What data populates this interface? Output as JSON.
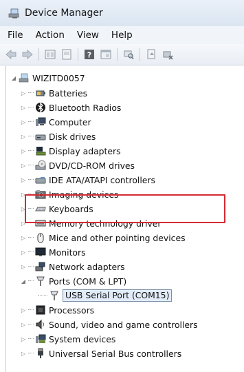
{
  "window": {
    "title": "Device Manager"
  },
  "menu": [
    "File",
    "Action",
    "View",
    "Help"
  ],
  "toolbar": {
    "buttons": [
      "back-icon",
      "forward-icon",
      "properties-icon",
      "update-icon",
      "help-icon",
      "console-icon",
      "scan-icon",
      "driver-icon",
      "disable-icon"
    ]
  },
  "tree": {
    "root": "WIZITD0057",
    "items": [
      {
        "label": "Batteries",
        "icon": "battery-icon"
      },
      {
        "label": "Bluetooth Radios",
        "icon": "bluetooth-icon"
      },
      {
        "label": "Computer",
        "icon": "computer-icon"
      },
      {
        "label": "Disk drives",
        "icon": "disk-drive-icon"
      },
      {
        "label": "Display adapters",
        "icon": "display-adapter-icon"
      },
      {
        "label": "DVD/CD-ROM drives",
        "icon": "dvd-drive-icon"
      },
      {
        "label": "IDE ATA/ATAPI controllers",
        "icon": "ide-controller-icon"
      },
      {
        "label": "Imaging devices",
        "icon": "imaging-device-icon"
      },
      {
        "label": "Keyboards",
        "icon": "keyboard-icon"
      },
      {
        "label": "Memory technology driver",
        "icon": "memory-icon"
      },
      {
        "label": "Mice and other pointing devices",
        "icon": "mouse-icon"
      },
      {
        "label": "Monitors",
        "icon": "monitor-icon"
      },
      {
        "label": "Network adapters",
        "icon": "network-adapter-icon"
      },
      {
        "label": "Ports (COM & LPT)",
        "icon": "port-icon",
        "expanded": true
      },
      {
        "label": "USB Serial Port (COM15)",
        "icon": "port-icon",
        "child": true,
        "selected": true
      },
      {
        "label": "Processors",
        "icon": "processor-icon"
      },
      {
        "label": "Sound, video and game controllers",
        "icon": "sound-icon"
      },
      {
        "label": "System devices",
        "icon": "system-device-icon"
      },
      {
        "label": "Universal Serial Bus controllers",
        "icon": "usb-icon"
      }
    ]
  },
  "colors": {
    "highlight": "#d52a33",
    "selection_bg": "#e2ecf8"
  }
}
